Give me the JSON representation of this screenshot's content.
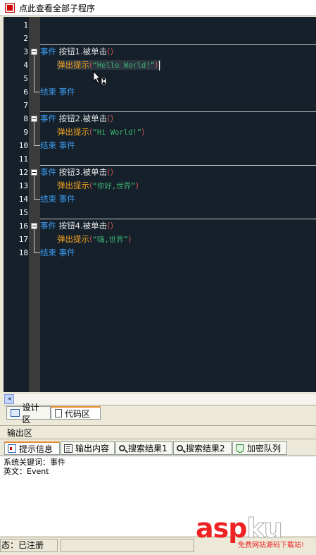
{
  "topbar": {
    "title": "点此查看全部子程序"
  },
  "editor": {
    "line_numbers": [
      "1",
      "2",
      "3",
      "4",
      "5",
      "6",
      "7",
      "8",
      "9",
      "10",
      "11",
      "12",
      "13",
      "14",
      "15",
      "16",
      "17",
      "18"
    ],
    "subs": [
      {
        "event_kw": "事件",
        "object_name": "按钮1.被单击",
        "paren": "()",
        "call_fn": "弹出提示",
        "open": "(",
        "arg": "“Hello World!”",
        "close": ")",
        "end_kw": "结束 事件"
      },
      {
        "event_kw": "事件",
        "object_name": "按钮2.被单击",
        "paren": "()",
        "call_fn": "弹出提示",
        "open": "(",
        "arg": "“Hi World!”",
        "close": ")",
        "end_kw": "结束 事件"
      },
      {
        "event_kw": "事件",
        "object_name": "按钮3.被单击",
        "paren": "()",
        "call_fn": "弹出提示",
        "open": "(",
        "arg": "“你好,世界”",
        "close": ")",
        "end_kw": "结束 事件"
      },
      {
        "event_kw": "事件",
        "object_name": "按钮4.被单击",
        "paren": "()",
        "call_fn": "弹出提示",
        "open": "(",
        "arg": "“嗨,世界”",
        "close": ")",
        "end_kw": "结束 事件"
      }
    ]
  },
  "view_tabs": {
    "design": "设计区",
    "code": "代码区"
  },
  "output": {
    "header": "输出区",
    "tabs": [
      "提示信息",
      "输出内容",
      "搜索结果1",
      "搜索结果2",
      "加密队列"
    ],
    "lines": [
      "系统关键词：事件",
      "英文：Event"
    ]
  },
  "status": {
    "text": "态：已注册"
  },
  "watermark": {
    "main_a": "asp",
    "main_b": "ku",
    "sub": "免费网站源码下载站!"
  },
  "colors": {
    "editor_bg": "#15202b",
    "keyword": "#3c9cf0",
    "function": "#f0a020",
    "string": "#3cb371",
    "paren": "#c85050"
  }
}
